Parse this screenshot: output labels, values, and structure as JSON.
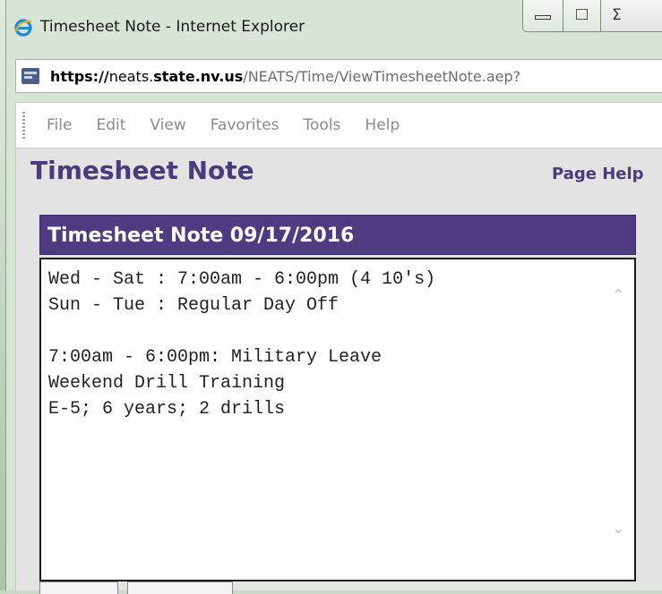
{
  "window": {
    "title": "Timesheet Note - Internet Explorer",
    "close_glyph": "Σ"
  },
  "address": {
    "scheme": "https://",
    "host_sub": "neats.",
    "host_main": "state.nv.us",
    "path": "/NEATS/Time/ViewTimesheetNote.aep?"
  },
  "menu": {
    "items": [
      "File",
      "Edit",
      "View",
      "Favorites",
      "Tools",
      "Help"
    ]
  },
  "page": {
    "title": "Timesheet Note",
    "help_link": "Page Help"
  },
  "note": {
    "header": "Timesheet Note 09/17/2016",
    "lines": [
      "Wed - Sat : 7:00am - 6:00pm (4 10's)",
      "Sun - Tue : Regular Day Off",
      "",
      "7:00am - 6:00pm: Military Leave",
      "Weekend Drill Training",
      "E-5; 6 years; 2 drills"
    ]
  },
  "icons": {
    "browser": "internet-explorer-icon",
    "site": "site-favicon-icon",
    "scroll_up": "chevron-up-icon",
    "scroll_down": "chevron-down-icon"
  },
  "colors": {
    "brand_purple": "#4e3b82",
    "title_purple": "#4a3a7e"
  }
}
